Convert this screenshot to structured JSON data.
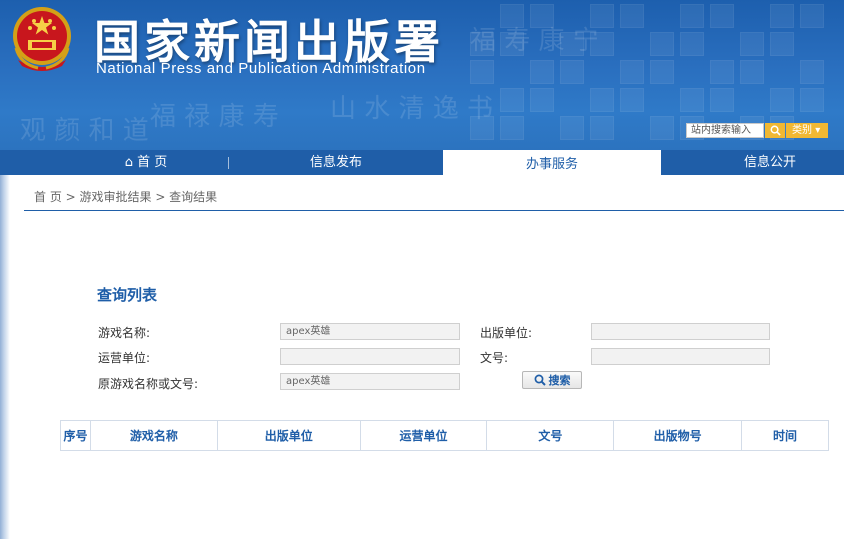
{
  "header": {
    "title_cn": "国家新闻出版署",
    "title_en": "National Press and Publication Administration",
    "search_placeholder": "站内搜索输入",
    "category_label": "类别"
  },
  "nav": {
    "items": [
      {
        "label": "首 页",
        "icon": "home-icon"
      },
      {
        "label": "信息发布"
      },
      {
        "label": "办事服务",
        "active": true
      },
      {
        "label": "信息公开"
      }
    ]
  },
  "breadcrumb": "首 页 > 游戏审批结果 > 查询结果",
  "query": {
    "title": "查询列表",
    "game_name_label": "游戏名称:",
    "game_name_value": "apex英雄",
    "publisher_label": "出版单位:",
    "publisher_value": "",
    "operator_label": "运营单位:",
    "operator_value": "",
    "doc_no_label": "文号:",
    "doc_no_value": "",
    "original_label": "原游戏名称或文号:",
    "original_value": "apex英雄",
    "search_button": "搜索"
  },
  "table": {
    "columns": [
      "序号",
      "游戏名称",
      "出版单位",
      "运营单位",
      "文号",
      "出版物号",
      "时间"
    ]
  },
  "colors": {
    "brand_blue": "#1f5ea8",
    "accent_gold": "#f1b833"
  }
}
